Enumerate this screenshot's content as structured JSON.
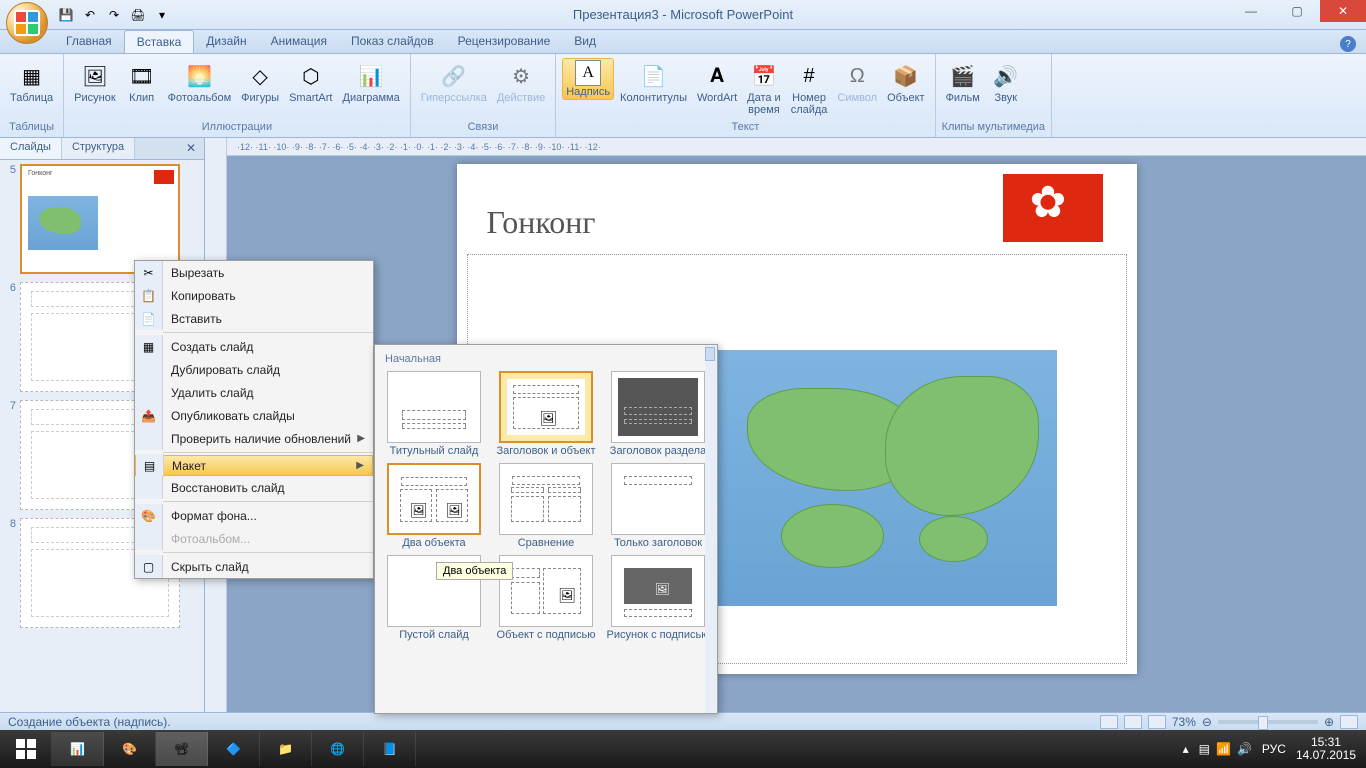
{
  "title": "Презентация3 - Microsoft PowerPoint",
  "tabs": [
    "Главная",
    "Вставка",
    "Дизайн",
    "Анимация",
    "Показ слайдов",
    "Рецензирование",
    "Вид"
  ],
  "active_tab": 1,
  "ribbon": {
    "groups": [
      {
        "label": "Таблицы",
        "items": [
          {
            "label": "Таблица",
            "icon": "table-icon"
          }
        ]
      },
      {
        "label": "Иллюстрации",
        "items": [
          {
            "label": "Рисунок",
            "icon": "picture-icon"
          },
          {
            "label": "Клип",
            "icon": "clip-icon"
          },
          {
            "label": "Фотоальбом",
            "icon": "album-icon"
          },
          {
            "label": "Фигуры",
            "icon": "shapes-icon"
          },
          {
            "label": "SmartArt",
            "icon": "smartart-icon"
          },
          {
            "label": "Диаграмма",
            "icon": "chart-icon"
          }
        ]
      },
      {
        "label": "Связи",
        "items": [
          {
            "label": "Гиперссылка",
            "icon": "link-icon",
            "disabled": true
          },
          {
            "label": "Действие",
            "icon": "action-icon",
            "disabled": true
          }
        ]
      },
      {
        "label": "Текст",
        "items": [
          {
            "label": "Надпись",
            "icon": "textbox-icon",
            "active": true
          },
          {
            "label": "Колонтитулы",
            "icon": "header-icon"
          },
          {
            "label": "WordArt",
            "icon": "wordart-icon"
          },
          {
            "label": "Дата и\nвремя",
            "icon": "date-icon"
          },
          {
            "label": "Номер\nслайда",
            "icon": "number-icon"
          },
          {
            "label": "Символ",
            "icon": "symbol-icon",
            "disabled": true
          },
          {
            "label": "Объект",
            "icon": "object-icon"
          }
        ]
      },
      {
        "label": "Клипы мультимедиа",
        "items": [
          {
            "label": "Фильм",
            "icon": "movie-icon"
          },
          {
            "label": "Звук",
            "icon": "sound-icon"
          }
        ]
      }
    ]
  },
  "panel_tabs": {
    "slides": "Слайды",
    "outline": "Структура"
  },
  "slides": [
    {
      "num": "5",
      "title": "Гонконг",
      "selected": true
    },
    {
      "num": "6",
      "blank": true
    },
    {
      "num": "7",
      "blank": true
    },
    {
      "num": "8",
      "blank": true
    }
  ],
  "slide_content": {
    "title": "Гонконг"
  },
  "ruler_h": "·12· ·11· ·10· ·9· ·8· ·7· ·6· ·5· ·4· ·3· ·2· ·1· ·0· ·1· ·2· ·3· ·4· ·5· ·6· ·7· ·8· ·9· ·10· ·11· ·12·",
  "context_menu": [
    {
      "label": "Вырезать",
      "icon": "✂"
    },
    {
      "label": "Копировать",
      "icon": "📋"
    },
    {
      "label": "Вставить",
      "icon": "📄"
    },
    {
      "sep": true
    },
    {
      "label": "Создать слайд",
      "icon": "▦"
    },
    {
      "label": "Дублировать слайд"
    },
    {
      "label": "Удалить слайд"
    },
    {
      "label": "Опубликовать слайды",
      "icon": "📤"
    },
    {
      "label": "Проверить наличие обновлений",
      "arrow": true
    },
    {
      "sep": true
    },
    {
      "label": "Макет",
      "icon": "▤",
      "arrow": true,
      "highlighted": true
    },
    {
      "label": "Восстановить слайд"
    },
    {
      "sep": true
    },
    {
      "label": "Формат фона...",
      "icon": "🎨"
    },
    {
      "label": "Фотоальбом...",
      "disabled": true
    },
    {
      "sep": true
    },
    {
      "label": "Скрыть слайд",
      "icon": "▢"
    }
  ],
  "layout_menu": {
    "header": "Начальная",
    "items": [
      {
        "label": "Титульный слайд",
        "type": "title"
      },
      {
        "label": "Заголовок и объект",
        "type": "title-content",
        "selected": true
      },
      {
        "label": "Заголовок раздела",
        "type": "section"
      },
      {
        "label": "Два объекта",
        "type": "two",
        "hover": true
      },
      {
        "label": "Сравнение",
        "type": "compare"
      },
      {
        "label": "Только заголовок",
        "type": "title-only"
      },
      {
        "label": "Пустой слайд",
        "type": "blank"
      },
      {
        "label": "Объект с подписью",
        "type": "caption"
      },
      {
        "label": "Рисунок с подписью",
        "type": "picture"
      }
    ],
    "tooltip": "Два объекта"
  },
  "statusbar": {
    "text": "Создание объекта (надпись).",
    "zoom": "73%"
  },
  "tray": {
    "lang": "РУС",
    "time": "15:31",
    "date": "14.07.2015"
  }
}
